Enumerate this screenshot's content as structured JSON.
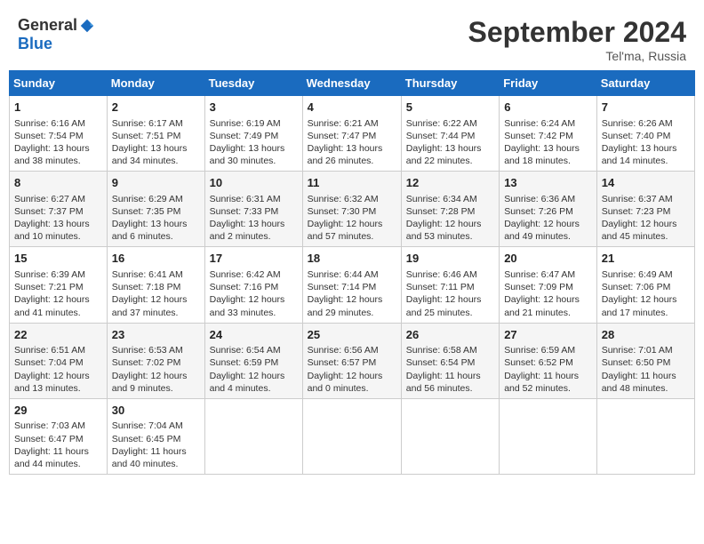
{
  "header": {
    "logo_general": "General",
    "logo_blue": "Blue",
    "month_title": "September 2024",
    "location": "Tel'ma, Russia"
  },
  "weekdays": [
    "Sunday",
    "Monday",
    "Tuesday",
    "Wednesday",
    "Thursday",
    "Friday",
    "Saturday"
  ],
  "weeks": [
    [
      {
        "day": "1",
        "text": "Sunrise: 6:16 AM\nSunset: 7:54 PM\nDaylight: 13 hours\nand 38 minutes."
      },
      {
        "day": "2",
        "text": "Sunrise: 6:17 AM\nSunset: 7:51 PM\nDaylight: 13 hours\nand 34 minutes."
      },
      {
        "day": "3",
        "text": "Sunrise: 6:19 AM\nSunset: 7:49 PM\nDaylight: 13 hours\nand 30 minutes."
      },
      {
        "day": "4",
        "text": "Sunrise: 6:21 AM\nSunset: 7:47 PM\nDaylight: 13 hours\nand 26 minutes."
      },
      {
        "day": "5",
        "text": "Sunrise: 6:22 AM\nSunset: 7:44 PM\nDaylight: 13 hours\nand 22 minutes."
      },
      {
        "day": "6",
        "text": "Sunrise: 6:24 AM\nSunset: 7:42 PM\nDaylight: 13 hours\nand 18 minutes."
      },
      {
        "day": "7",
        "text": "Sunrise: 6:26 AM\nSunset: 7:40 PM\nDaylight: 13 hours\nand 14 minutes."
      }
    ],
    [
      {
        "day": "8",
        "text": "Sunrise: 6:27 AM\nSunset: 7:37 PM\nDaylight: 13 hours\nand 10 minutes."
      },
      {
        "day": "9",
        "text": "Sunrise: 6:29 AM\nSunset: 7:35 PM\nDaylight: 13 hours\nand 6 minutes."
      },
      {
        "day": "10",
        "text": "Sunrise: 6:31 AM\nSunset: 7:33 PM\nDaylight: 13 hours\nand 2 minutes."
      },
      {
        "day": "11",
        "text": "Sunrise: 6:32 AM\nSunset: 7:30 PM\nDaylight: 12 hours\nand 57 minutes."
      },
      {
        "day": "12",
        "text": "Sunrise: 6:34 AM\nSunset: 7:28 PM\nDaylight: 12 hours\nand 53 minutes."
      },
      {
        "day": "13",
        "text": "Sunrise: 6:36 AM\nSunset: 7:26 PM\nDaylight: 12 hours\nand 49 minutes."
      },
      {
        "day": "14",
        "text": "Sunrise: 6:37 AM\nSunset: 7:23 PM\nDaylight: 12 hours\nand 45 minutes."
      }
    ],
    [
      {
        "day": "15",
        "text": "Sunrise: 6:39 AM\nSunset: 7:21 PM\nDaylight: 12 hours\nand 41 minutes."
      },
      {
        "day": "16",
        "text": "Sunrise: 6:41 AM\nSunset: 7:18 PM\nDaylight: 12 hours\nand 37 minutes."
      },
      {
        "day": "17",
        "text": "Sunrise: 6:42 AM\nSunset: 7:16 PM\nDaylight: 12 hours\nand 33 minutes."
      },
      {
        "day": "18",
        "text": "Sunrise: 6:44 AM\nSunset: 7:14 PM\nDaylight: 12 hours\nand 29 minutes."
      },
      {
        "day": "19",
        "text": "Sunrise: 6:46 AM\nSunset: 7:11 PM\nDaylight: 12 hours\nand 25 minutes."
      },
      {
        "day": "20",
        "text": "Sunrise: 6:47 AM\nSunset: 7:09 PM\nDaylight: 12 hours\nand 21 minutes."
      },
      {
        "day": "21",
        "text": "Sunrise: 6:49 AM\nSunset: 7:06 PM\nDaylight: 12 hours\nand 17 minutes."
      }
    ],
    [
      {
        "day": "22",
        "text": "Sunrise: 6:51 AM\nSunset: 7:04 PM\nDaylight: 12 hours\nand 13 minutes."
      },
      {
        "day": "23",
        "text": "Sunrise: 6:53 AM\nSunset: 7:02 PM\nDaylight: 12 hours\nand 9 minutes."
      },
      {
        "day": "24",
        "text": "Sunrise: 6:54 AM\nSunset: 6:59 PM\nDaylight: 12 hours\nand 4 minutes."
      },
      {
        "day": "25",
        "text": "Sunrise: 6:56 AM\nSunset: 6:57 PM\nDaylight: 12 hours\nand 0 minutes."
      },
      {
        "day": "26",
        "text": "Sunrise: 6:58 AM\nSunset: 6:54 PM\nDaylight: 11 hours\nand 56 minutes."
      },
      {
        "day": "27",
        "text": "Sunrise: 6:59 AM\nSunset: 6:52 PM\nDaylight: 11 hours\nand 52 minutes."
      },
      {
        "day": "28",
        "text": "Sunrise: 7:01 AM\nSunset: 6:50 PM\nDaylight: 11 hours\nand 48 minutes."
      }
    ],
    [
      {
        "day": "29",
        "text": "Sunrise: 7:03 AM\nSunset: 6:47 PM\nDaylight: 11 hours\nand 44 minutes."
      },
      {
        "day": "30",
        "text": "Sunrise: 7:04 AM\nSunset: 6:45 PM\nDaylight: 11 hours\nand 40 minutes."
      },
      null,
      null,
      null,
      null,
      null
    ]
  ]
}
